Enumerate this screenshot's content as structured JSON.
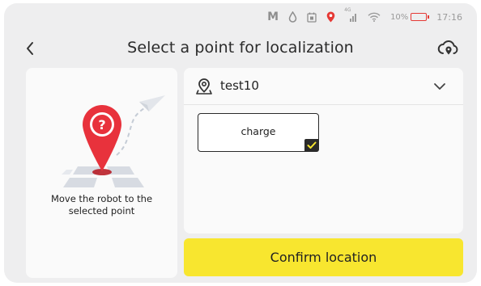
{
  "status_bar": {
    "carrier_letter": "M",
    "signal_label": "4G",
    "battery_text": "10%",
    "time": "17:16",
    "battery_color": "#e53935",
    "location_pin_color": "#e53935",
    "icons": [
      "m-icon",
      "droplet-icon",
      "calendar-icon",
      "location-pin-icon",
      "cellular-signal-icon",
      "wifi-icon",
      "battery-low-icon"
    ]
  },
  "header": {
    "title": "Select a point for localization",
    "back_icon": "chevron-left-icon",
    "action_icon": "cloud-location-icon"
  },
  "left_panel": {
    "instruction": "Move the robot to the selected point",
    "illustration_icon": "robot-question-pin-icon"
  },
  "map_selector": {
    "map_name": "test10",
    "icon": "map-pin-icon",
    "dropdown_icon": "chevron-down-icon"
  },
  "points": [
    {
      "label": "charge",
      "selected": true
    }
  ],
  "confirm_button": {
    "label": "Confirm location",
    "color": "#f8e62f"
  }
}
